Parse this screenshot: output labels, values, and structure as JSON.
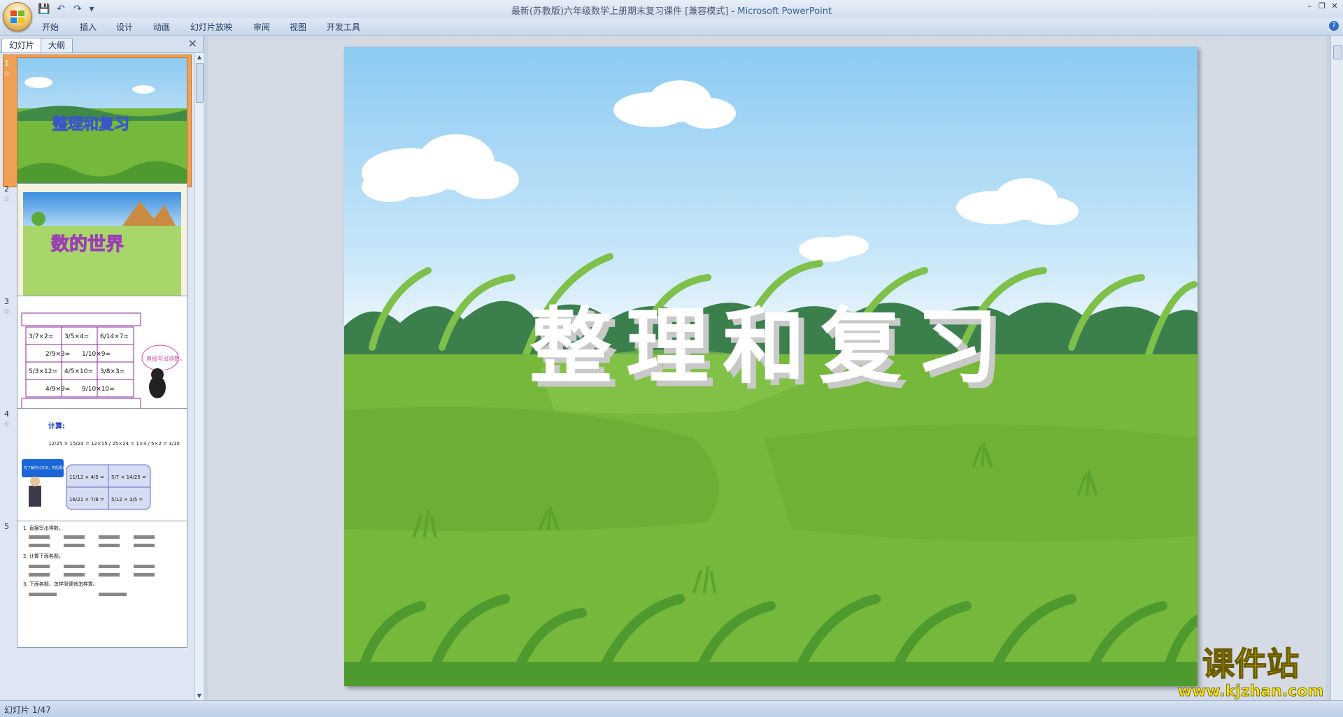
{
  "window": {
    "title": "最新(苏教版)六年级数学上册期末复习课件 [兼容模式] - ",
    "app_name": "Microsoft PowerPoint"
  },
  "quick_access": {
    "save": "💾",
    "undo": "↶",
    "redo": "↷",
    "customize": "▾"
  },
  "ribbon": {
    "tabs": [
      "开始",
      "插入",
      "设计",
      "动画",
      "幻灯片放映",
      "审阅",
      "视图",
      "开发工具"
    ]
  },
  "panel": {
    "tabs": {
      "slides": "幻灯片",
      "outline": "大纲"
    },
    "close": "✕"
  },
  "thumbnails": [
    {
      "num": "1",
      "star": "☆",
      "title": "整理和复习"
    },
    {
      "num": "2",
      "star": "☆",
      "title": "数的世界"
    },
    {
      "num": "3",
      "star": "☆",
      "rows": [
        [
          "3/7×2=",
          "3/5×4=",
          "6/14×7="
        ],
        [
          "2/9×3=",
          "1/10×9="
        ],
        [
          "5/3×12=",
          "4/5×10=",
          "3/8×3="
        ],
        [
          "4/9×9=",
          "9/10×10="
        ]
      ],
      "bubble": "直接写出得数。"
    },
    {
      "num": "4",
      "star": "☆",
      "calc_label": "计算:",
      "example": "12/25 × 15/24 = 12×15 / 25×24 = 1×3 / 5×2 = 3/10",
      "tip": "先了解约分方法，然后再计算",
      "exercises": [
        "11/12 × 4/5 =",
        "5/7 × 14/25 =",
        "16/21 × 7/8 =",
        "5/12 × 3/5 ="
      ]
    },
    {
      "num": "5",
      "star": "",
      "lines": [
        "1. 直接写出得数。",
        "2. 计算下面各题。",
        "3. 下面各题，怎样简便就怎样算。"
      ]
    }
  ],
  "slide": {
    "title": "整理和复习"
  },
  "status": {
    "slide_indicator": "幻灯片 1/47"
  },
  "watermark": {
    "text": "课件站",
    "url": "www.kjzhan.com"
  },
  "colors": {
    "sky_top": "#8dcaf2",
    "sky_bottom": "#e8f4fb",
    "grass": "#74b83c",
    "grass_dark": "#4f9a2e",
    "thumb_selected": "#f0a054",
    "watermark_yellow": "#f5e61c"
  }
}
